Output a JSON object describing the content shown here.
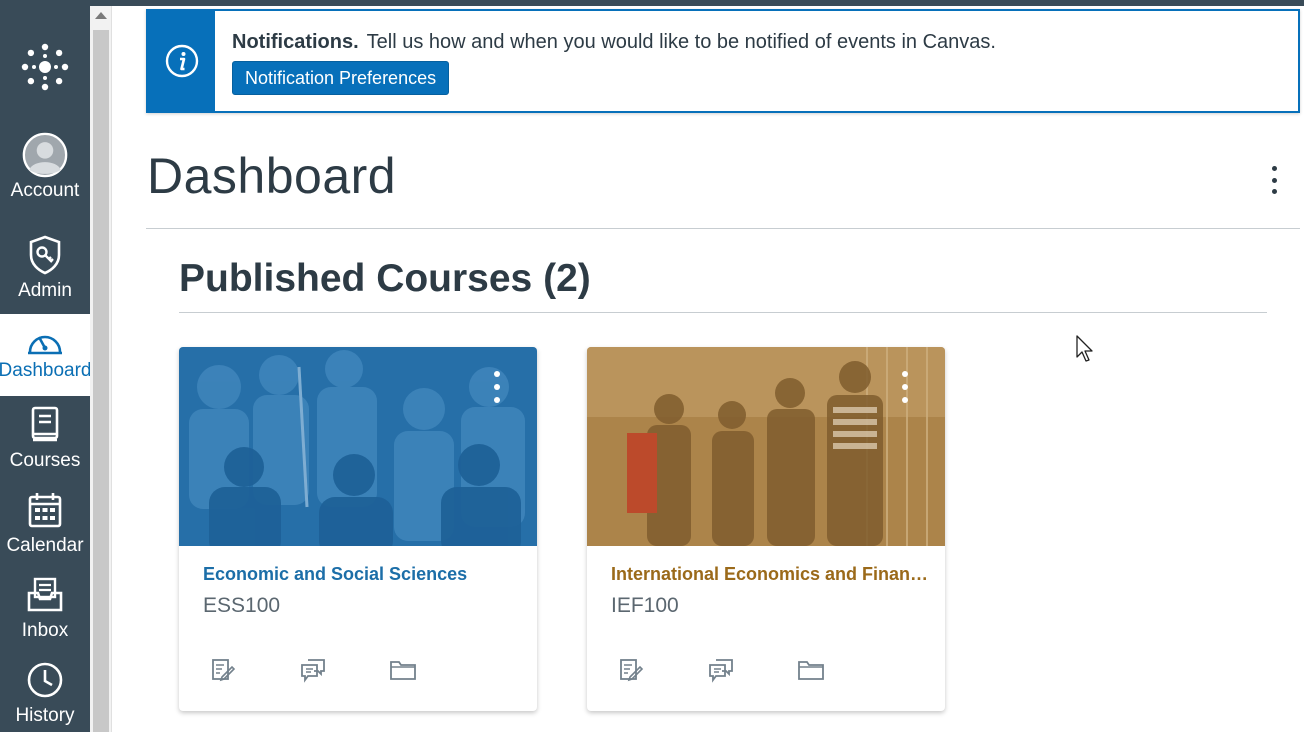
{
  "nav": {
    "account": "Account",
    "admin": "Admin",
    "dashboard": "Dashboard",
    "courses": "Courses",
    "calendar": "Calendar",
    "inbox": "Inbox",
    "history": "History"
  },
  "notification": {
    "title": "Notifications.",
    "message": "Tell us how and when you would like to be notified of events in Canvas.",
    "button": "Notification Preferences"
  },
  "page": {
    "title": "Dashboard"
  },
  "section": {
    "title": "Published Courses (2)"
  },
  "courses": [
    {
      "name": "Economic and Social Sciences",
      "code": "ESS100",
      "color": "#1c6ea8"
    },
    {
      "name": "International Economics and Finance",
      "code": "IEF100",
      "color": "#9b6a1a"
    }
  ],
  "colors": {
    "nav_bg": "#394b58",
    "brand_blue": "#0770ba",
    "text": "#2d3b45"
  }
}
